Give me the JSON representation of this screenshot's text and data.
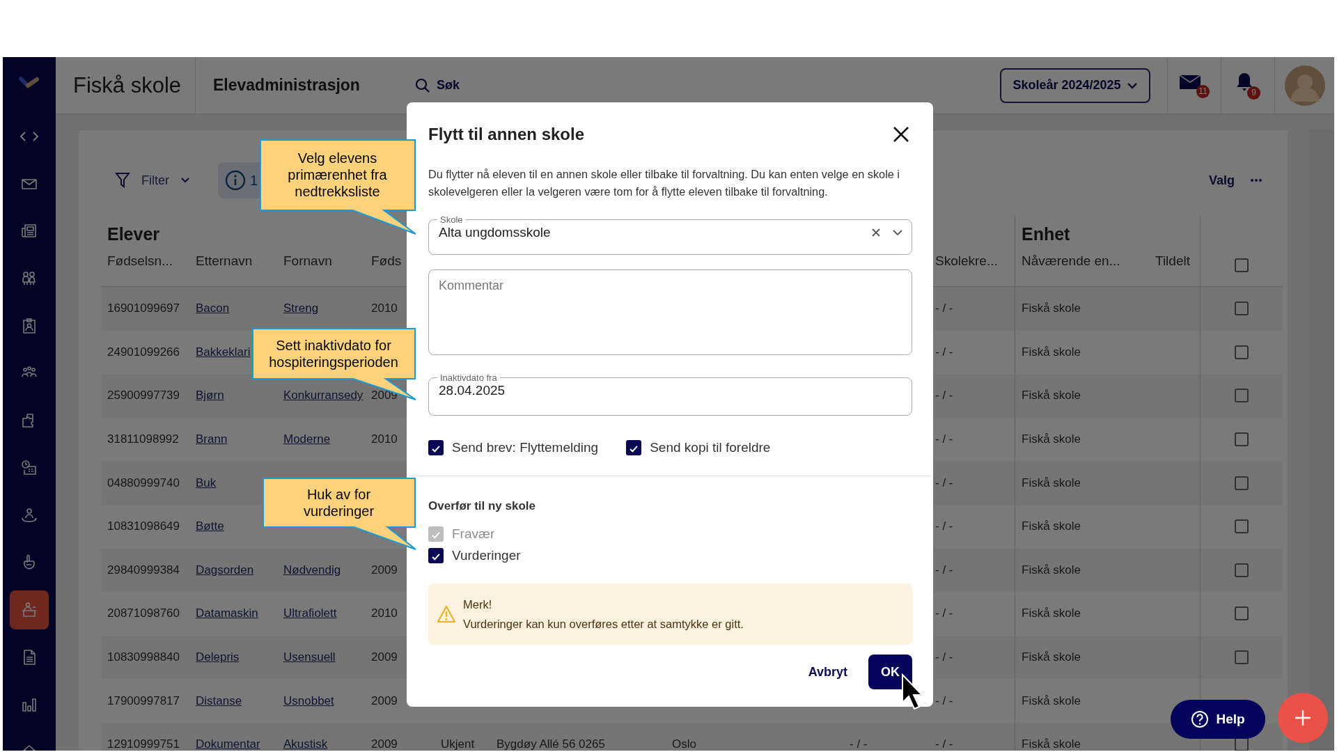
{
  "app": {
    "school": "Fiskå skole",
    "module": "Elevadministrasjon",
    "search": "Søk",
    "school_year": "Skoleår 2024/2025",
    "mail_count": "11",
    "notification_count": "9"
  },
  "sidebar": {
    "items": [
      {
        "selected": false
      },
      {
        "selected": false
      },
      {
        "selected": false
      },
      {
        "selected": false
      },
      {
        "selected": false
      },
      {
        "selected": false
      },
      {
        "selected": false
      },
      {
        "selected": false
      },
      {
        "selected": false
      },
      {
        "selected": true
      },
      {
        "selected": false
      },
      {
        "selected": false
      },
      {
        "selected": false
      }
    ]
  },
  "toolbar": {
    "filter": "Filter",
    "info_count": "1",
    "options": "Valg"
  },
  "table": {
    "title": "Elever",
    "group_title": "Enhet",
    "header_checked": false,
    "columns": {
      "fodselsnummer": "Fødselsn...",
      "etternavn": "Etternavn",
      "fornavn": "Fornavn",
      "column_4": "Føds",
      "skolekrets": "Skolekre...",
      "navaerende_enhet": "Nåværende en...",
      "tildelt": "Tildelt"
    },
    "rows": [
      {
        "fodselsnummer": "16901099697",
        "etternavn": "Bacon",
        "fornavn": "Streng",
        "column_4": "2010",
        "skolekrets": "- / -",
        "navaerende_enhet": "Fiskå skole",
        "checked": false
      },
      {
        "fodselsnummer": "24901099266",
        "etternavn": "Bakkeklari",
        "skolekrets": "- / -",
        "navaerende_enhet": "Fiskå skole",
        "checked": false
      },
      {
        "fodselsnummer": "25900997739",
        "etternavn": "Bjørn",
        "fornavn": "Konkurransedy",
        "column_4": "2009",
        "skolekrets": "- / -",
        "navaerende_enhet": "Fiskå skole",
        "checked": false
      },
      {
        "fodselsnummer": "31811098992",
        "etternavn": "Brann",
        "fornavn": "Moderne",
        "column_4": "2010",
        "skolekrets": "- / -",
        "navaerende_enhet": "Fiskå skole",
        "checked": false
      },
      {
        "fodselsnummer": "04880999740",
        "etternavn": "Buk",
        "skolekrets": "- / -",
        "navaerende_enhet": "Fiskå skole",
        "checked": false
      },
      {
        "fodselsnummer": "10831098649",
        "etternavn": "Bøtte",
        "skolekrets": "- / -",
        "navaerende_enhet": "Fiskå skole",
        "checked": false
      },
      {
        "fodselsnummer": "29840999384",
        "etternavn": "Dagsorden",
        "fornavn": "Nødvendig",
        "column_4": "2009",
        "skolekrets": "- / -",
        "navaerende_enhet": "Fiskå skole",
        "checked": false
      },
      {
        "fodselsnummer": "20871098760",
        "etternavn": "Datamaskin",
        "fornavn": "Ultrafiolett",
        "column_4": "2010",
        "skolekrets": "- / -",
        "navaerende_enhet": "Fiskå skole",
        "checked": false
      },
      {
        "fodselsnummer": "10830998840",
        "etternavn": "Delepris",
        "fornavn": "Usensuell",
        "column_4": "2009",
        "skolekrets": "- / -",
        "navaerende_enhet": "Fiskå skole",
        "checked": false
      },
      {
        "fodselsnummer": "17900997817",
        "etternavn": "Distanse",
        "fornavn": "Usnobbet",
        "column_4": "2009",
        "skolekrets": "- / -",
        "navaerende_enhet": "Fiskå skole"
      },
      {
        "fodselsnummer": "12910999751",
        "etternavn": "Dokumentar",
        "fornavn": "Akustisk",
        "column_4": "2009",
        "column_5": "Ukjent",
        "column_6": "Bygdøy Allé 56  0265",
        "column_7": "Oslo",
        "column_8": "- / -",
        "skolekrets": "- / -",
        "navaerende_enhet": "Fiskå skole",
        "checked": false
      }
    ]
  },
  "dialog": {
    "title": "Flytt til annen skole",
    "description": "Du flytter nå eleven til en annen skole eller tilbake til forvaltning. Du kan enten velge en skole i skolevelgeren eller la velgeren være tom for å flytte eleven tilbake til forvaltning.",
    "school_field": {
      "label": "Skole",
      "value": "Alta ungdomsskole"
    },
    "comment_field": {
      "placeholder": "Kommentar"
    },
    "date_field": {
      "label": "Inaktivdato fra",
      "value": "28.04.2025"
    },
    "send_options": [
      {
        "label": "Send brev: Flyttemelding",
        "checked": true,
        "disabled": false
      },
      {
        "label": "Send kopi til foreldre",
        "checked": true,
        "disabled": false
      }
    ],
    "transfer": {
      "heading": "Overfør til ny skole",
      "options": [
        {
          "label": "Fravær",
          "checked": true,
          "disabled": true
        },
        {
          "label": "Vurderinger",
          "checked": true,
          "disabled": false
        }
      ]
    },
    "notice": {
      "title": "Merk!",
      "text": "Vurderinger kan kun overføres etter at samtykke er gitt."
    },
    "buttons": {
      "cancel": "Avbryt",
      "ok": "OK"
    }
  },
  "callouts": [
    {
      "text": "Velg elevens primærenhet fra nedtrekksliste"
    },
    {
      "text": "Sett inaktivdato for hospiteringsperioden"
    },
    {
      "text": "Huk av for vurderinger"
    }
  ],
  "help_button": "Help"
}
